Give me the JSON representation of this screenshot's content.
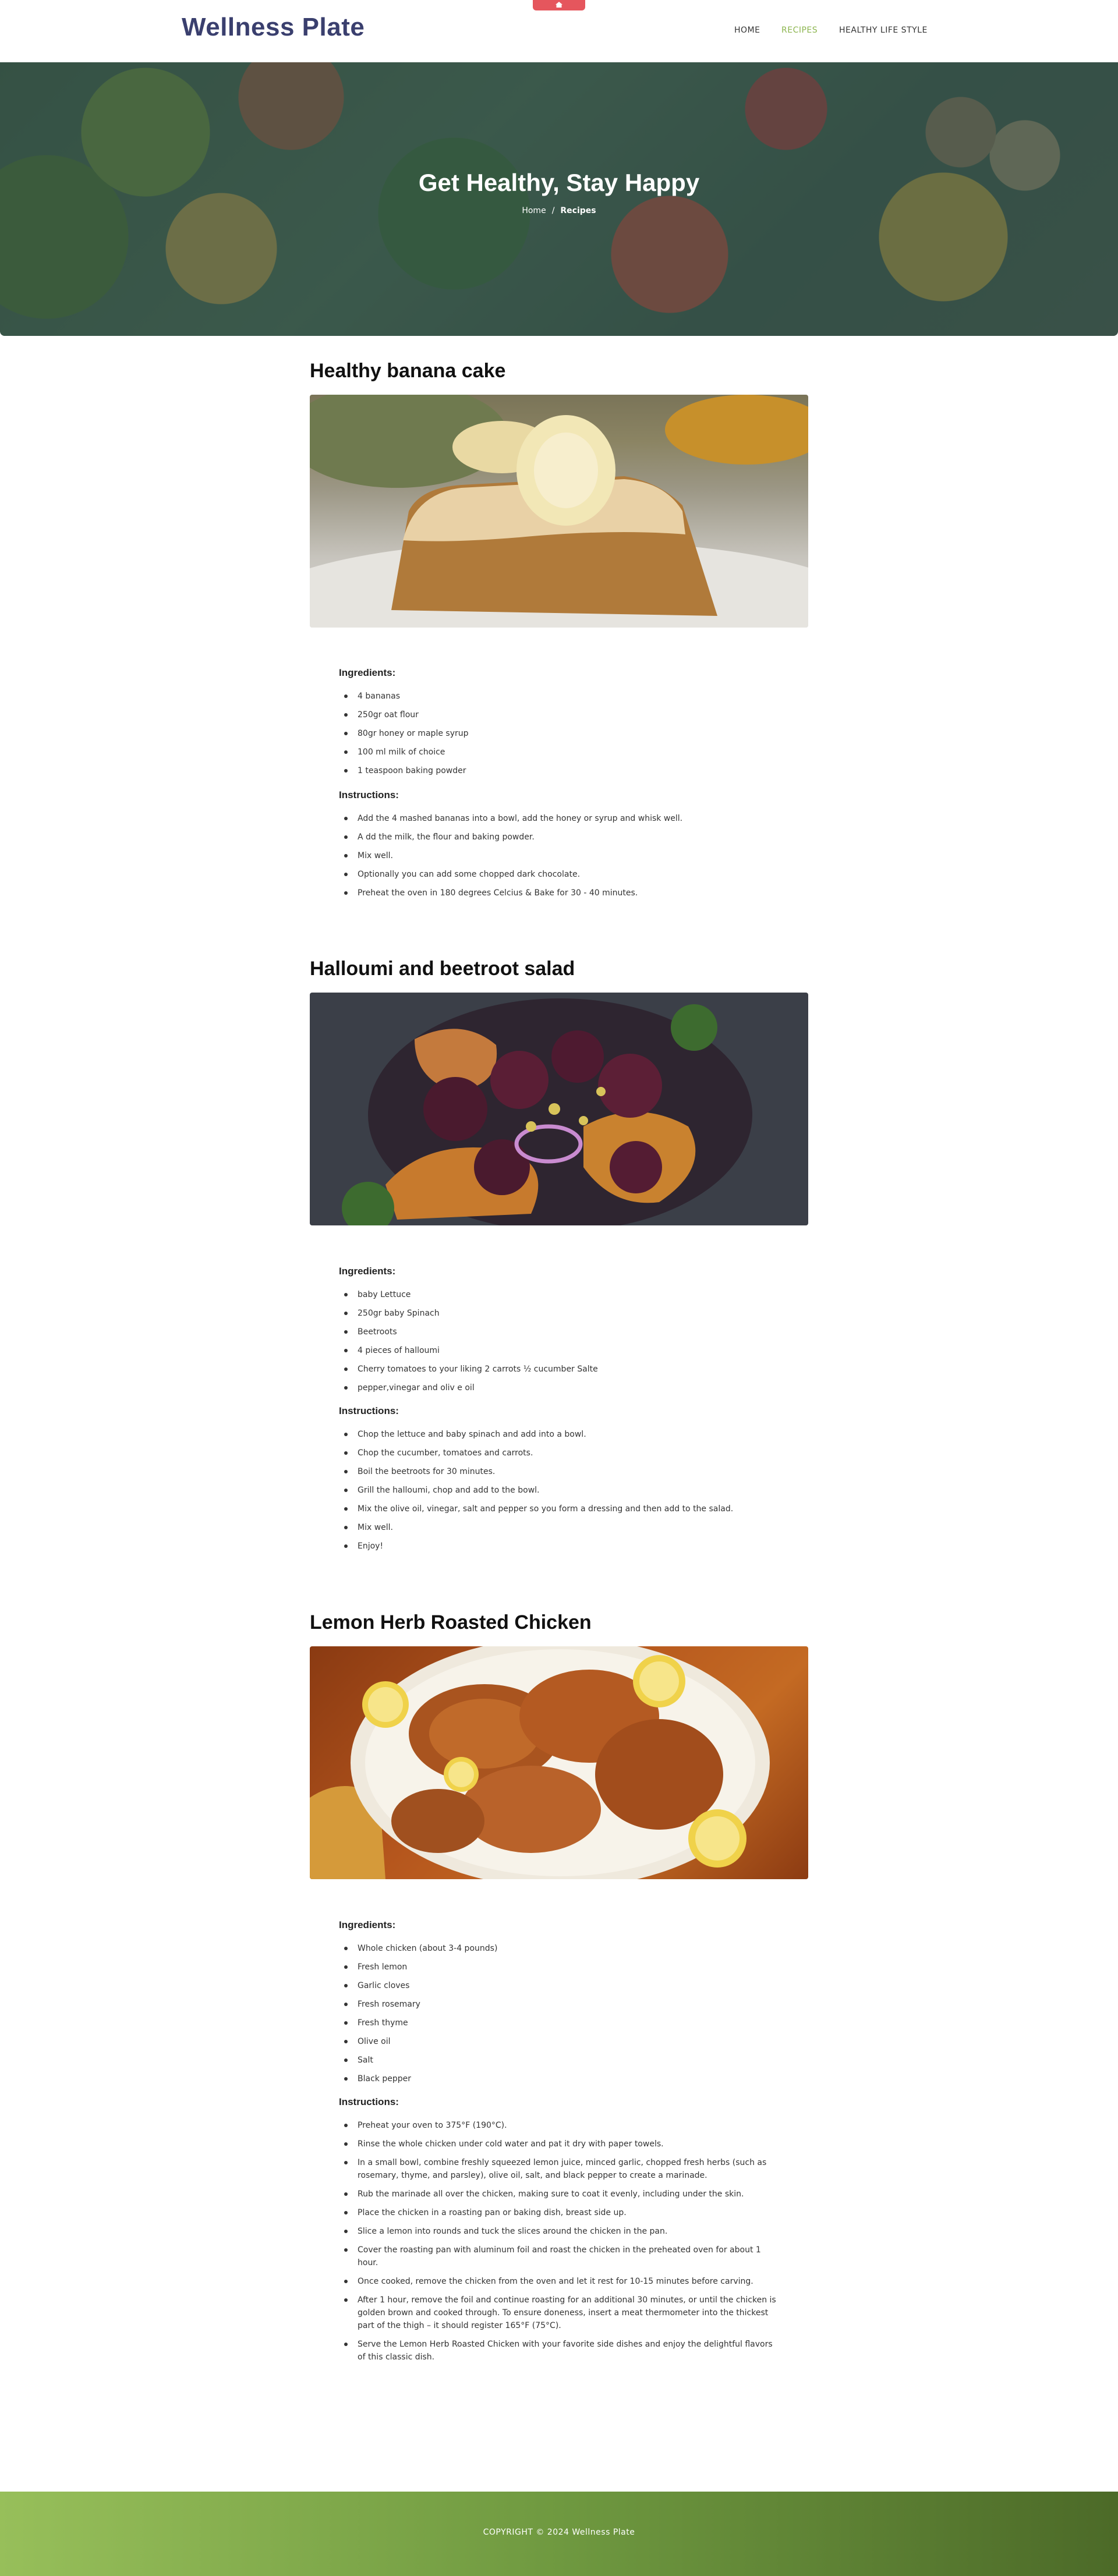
{
  "header": {
    "logo": "Wellness Plate",
    "nav": [
      {
        "label": "HOME"
      },
      {
        "label": "RECIPES"
      },
      {
        "label": "HEALTHY LIFE STYLE"
      }
    ],
    "accent_color": "#8cb54f",
    "brand_color": "#3a3f6e",
    "tab_color": "#e5565d",
    "tab_icon": "home-icon"
  },
  "hero": {
    "title": "Get Healthy, Stay Happy",
    "breadcrumb_home": "Home",
    "breadcrumb_sep": "/",
    "breadcrumb_current": "Recipes"
  },
  "recipes": [
    {
      "title": "Healthy banana cake",
      "image": "banana-cake-photo",
      "ingredients_label": "Ingredients:",
      "ingredients": [
        "4 bananas",
        "250gr oat flour",
        "80gr honey or maple syrup",
        "100 ml milk of choice",
        "1 teaspoon baking powder"
      ],
      "instructions_label": "Instructions:",
      "instructions": [
        "Add the 4 mashed bananas into a bowl, add the honey or syrup and whisk well.",
        "A dd the milk, the flour and baking powder.",
        "Mix well.",
        "Optionally you can add some chopped dark chocolate.",
        "Preheat the oven in 180 degrees Celcius & Bake for 30 - 40 minutes."
      ]
    },
    {
      "title": "Halloumi and beetroot salad",
      "image": "halloumi-beetroot-salad-photo",
      "ingredients_label": "Ingredients:",
      "ingredients": [
        "baby Lettuce",
        "250gr baby Spinach",
        "Beetroots",
        "4 pieces of halloumi",
        "Cherry tomatoes to your liking 2 carrots ½ cucumber Salte",
        "pepper,vinegar and oliv e oil"
      ],
      "instructions_label": "Instructions:",
      "instructions": [
        "Chop the lettuce and baby spinach and add into a bowl.",
        "Chop the cucumber, tomatoes and carrots.",
        "Boil the beetroots for 30 minutes.",
        "Grill the halloumi, chop and add to the bowl.",
        "Mix the olive oil, vinegar, salt and pepper so you form a dressing and then add to the salad.",
        "Mix well.",
        "Enjoy!"
      ]
    },
    {
      "title": "Lemon Herb Roasted Chicken",
      "image": "roasted-chicken-photo",
      "ingredients_label": "Ingredients:",
      "ingredients": [
        "Whole chicken (about 3-4 pounds)",
        "Fresh lemon",
        "Garlic cloves",
        "Fresh rosemary",
        "Fresh thyme",
        "Olive oil",
        "Salt",
        "Black pepper"
      ],
      "instructions_label": "Instructions:",
      "instructions": [
        "Preheat your oven to 375°F (190°C).",
        "Rinse the whole chicken under cold water and pat it dry with paper towels.",
        "In a small bowl, combine freshly squeezed lemon juice, minced garlic, chopped fresh herbs (such as rosemary, thyme, and parsley), olive oil, salt, and black pepper to create a marinade.",
        "Rub the marinade all over the chicken, making sure to coat it evenly, including under the skin.",
        "Place the chicken in a roasting pan or baking dish, breast side up.",
        "Slice a lemon into rounds and tuck the slices around the chicken in the pan.",
        "Cover the roasting pan with aluminum foil and roast the chicken in the preheated oven for about 1 hour.",
        "Once cooked, remove the chicken from the oven and let it rest for 10-15 minutes before carving.",
        "After 1 hour, remove the foil and continue roasting for an additional 30 minutes, or until the chicken is golden brown and cooked through. To ensure doneness, insert a meat thermometer into the thickest part of the thigh – it should register 165°F (75°C).",
        "Serve the Lemon Herb Roasted Chicken with your favorite side dishes and enjoy the delightful flavors of this classic dish."
      ]
    }
  ],
  "footer": {
    "copyright": "COPYRIGHT © 2024 Wellness Plate"
  }
}
